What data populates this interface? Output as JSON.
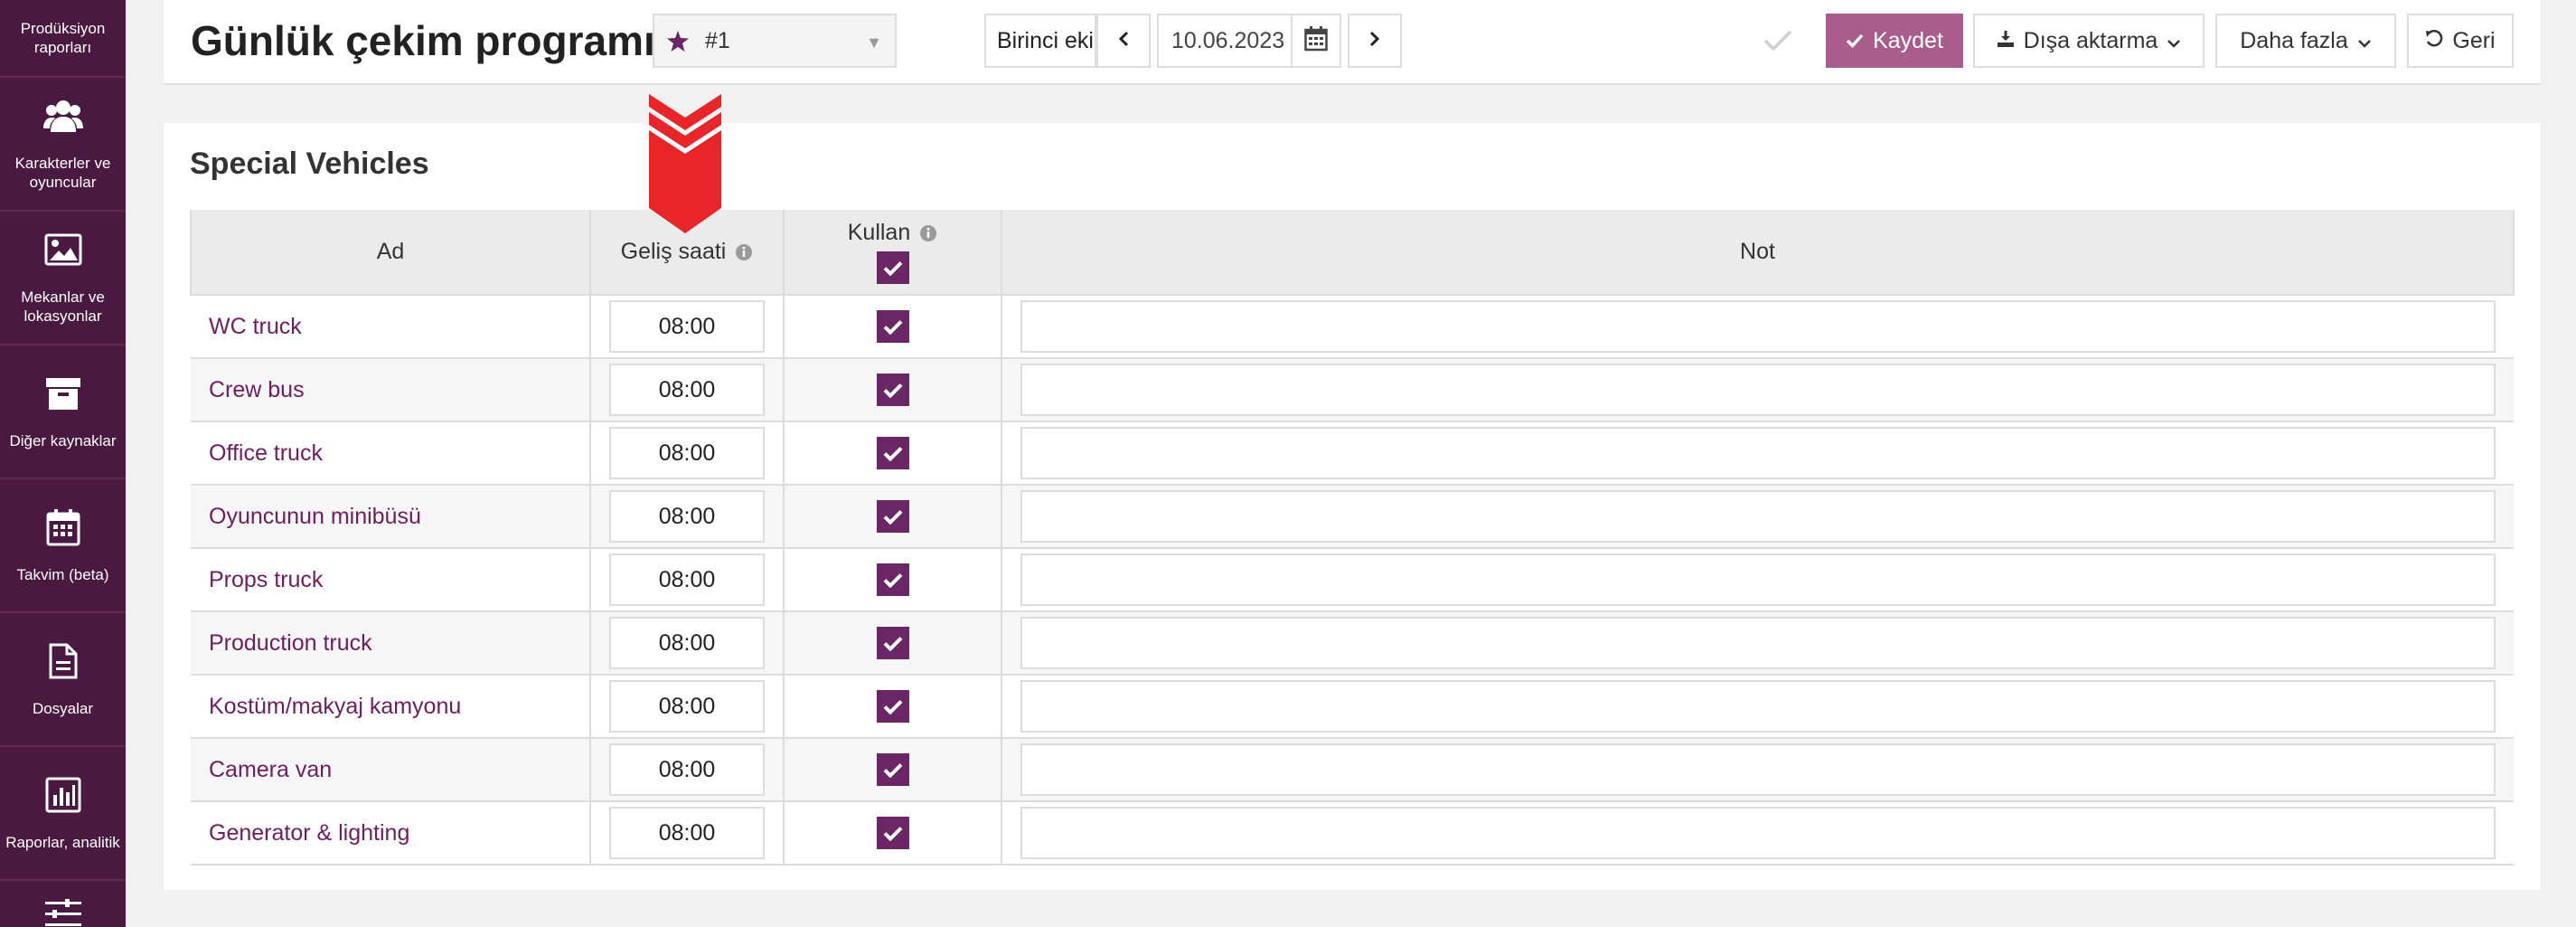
{
  "sidebar": {
    "items": [
      {
        "label": "Prodüksiyon raporları",
        "icon": "reports-icon"
      },
      {
        "label": "Karakterler ve oyuncular",
        "icon": "users-icon"
      },
      {
        "label": "Mekanlar ve lokasyonlar",
        "icon": "image-icon"
      },
      {
        "label": "Diğer kaynaklar",
        "icon": "archive-icon"
      },
      {
        "label": "Takvim (beta)",
        "icon": "calendar-icon"
      },
      {
        "label": "Dosyalar",
        "icon": "file-icon"
      },
      {
        "label": "Raporlar, analitik",
        "icon": "bar-chart-icon"
      },
      {
        "label": "",
        "icon": "sliders-icon"
      }
    ]
  },
  "header": {
    "title": "Günlük çekim programı",
    "project_select": {
      "value": "#1",
      "icon": "star-icon"
    },
    "unit_value": "Birinci ekip",
    "date_value": "10.06.2023",
    "save_label": "Kaydet",
    "export_label": "Dışa aktarma",
    "more_label": "Daha fazla",
    "back_label": "Geri"
  },
  "section": {
    "title": "Special Vehicles",
    "columns": {
      "name": "Ad",
      "arrival": "Geliş saati",
      "use": "Kullan",
      "note": "Not"
    },
    "rows": [
      {
        "name": "WC truck",
        "time": "08:00",
        "use": true,
        "note": ""
      },
      {
        "name": "Crew bus",
        "time": "08:00",
        "use": true,
        "note": ""
      },
      {
        "name": "Office truck",
        "time": "08:00",
        "use": true,
        "note": ""
      },
      {
        "name": "Oyuncunun minibüsü",
        "time": "08:00",
        "use": true,
        "note": ""
      },
      {
        "name": "Props truck",
        "time": "08:00",
        "use": true,
        "note": ""
      },
      {
        "name": "Production truck",
        "time": "08:00",
        "use": true,
        "note": ""
      },
      {
        "name": "Kostüm/makyaj kamyonu",
        "time": "08:00",
        "use": true,
        "note": ""
      },
      {
        "name": "Camera van",
        "time": "08:00",
        "use": true,
        "note": ""
      },
      {
        "name": "Generator & lighting",
        "time": "08:00",
        "use": true,
        "note": ""
      }
    ]
  },
  "colors": {
    "sidebar_bg": "#4a1942",
    "accent": "#6b2765",
    "save_button": "#a85d8d",
    "link": "#6e1e5e",
    "arrow": "#e8262a"
  }
}
